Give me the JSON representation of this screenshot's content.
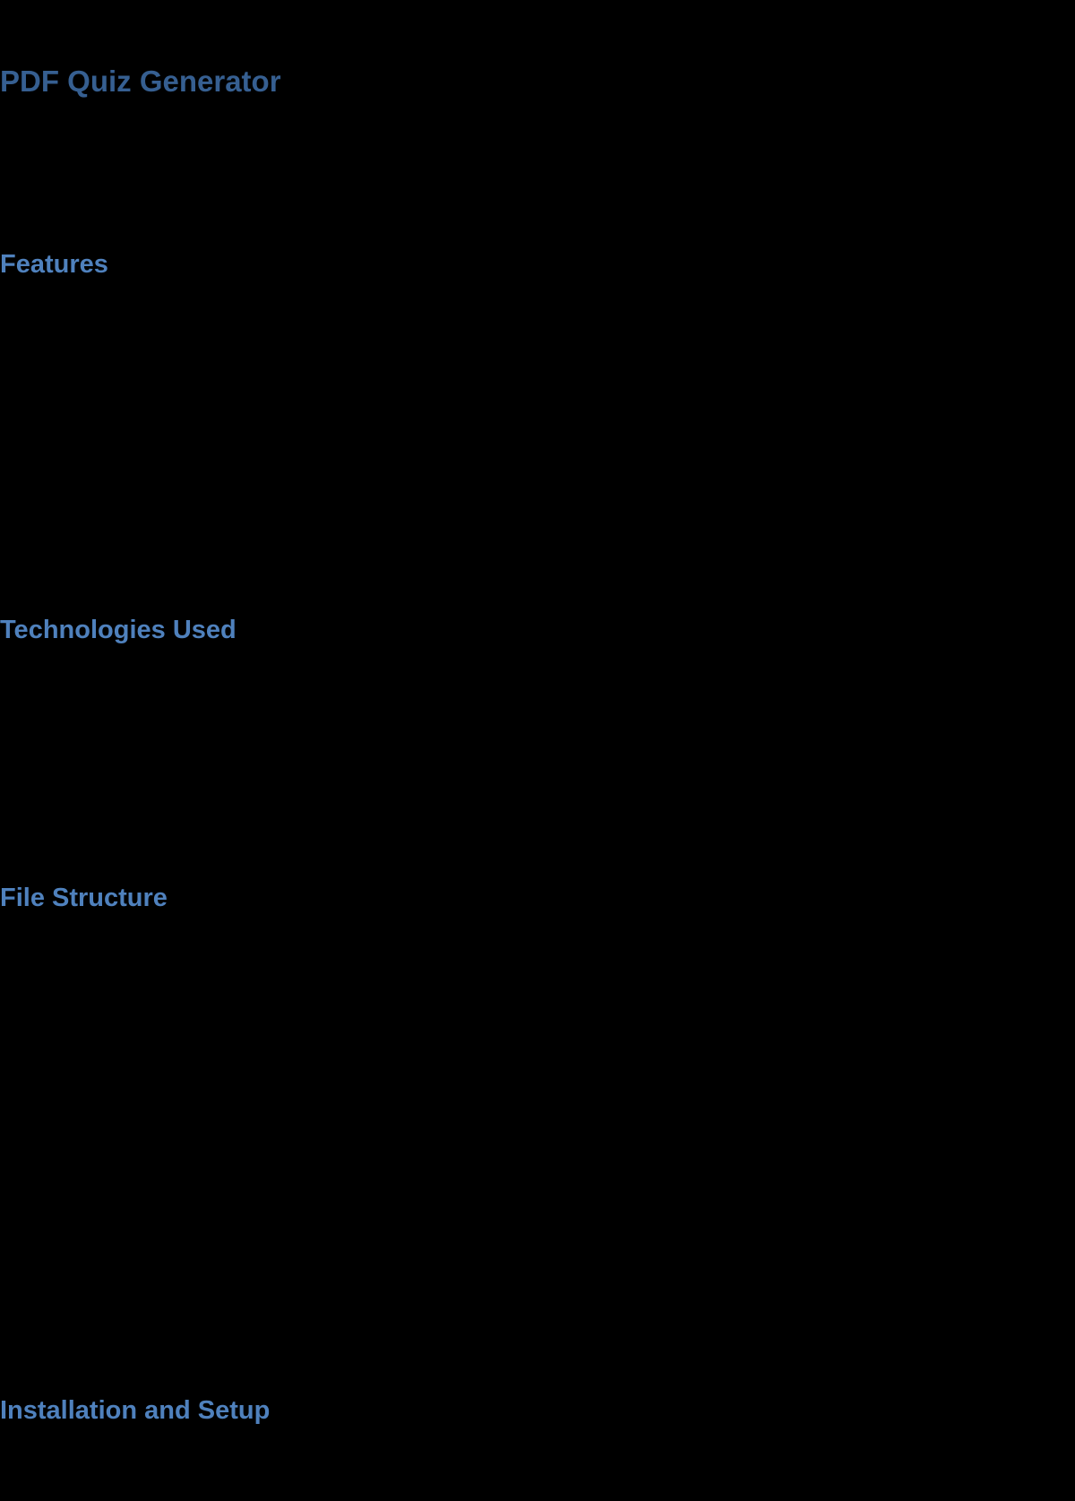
{
  "document": {
    "title": "PDF Quiz Generator",
    "sections": [
      {
        "heading": "Features"
      },
      {
        "heading": "Technologies Used"
      },
      {
        "heading": "File Structure"
      },
      {
        "heading": "Installation and Setup"
      }
    ]
  },
  "colors": {
    "background": "#000000",
    "title": "#365f91",
    "section_heading": "#4f81bd"
  }
}
